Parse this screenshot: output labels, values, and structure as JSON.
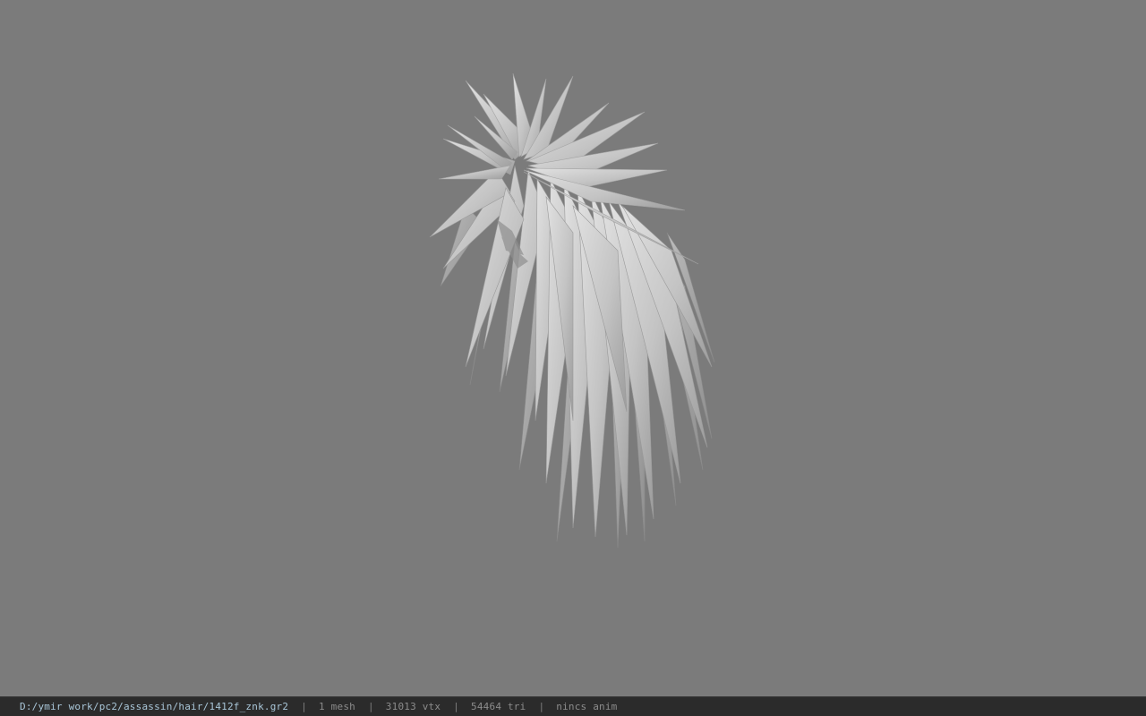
{
  "viewport": {
    "background": "#7b7b7b",
    "model_color": "#c9c9c9",
    "model_shadow": "#9a9a9a"
  },
  "status": {
    "file_path": "D:/ymir work/pc2/assassin/hair/1412f_znk.gr2",
    "separator": "|",
    "mesh": "1 mesh",
    "vtx": "31013 vtx",
    "tri": "54464 tri",
    "anim": "nincs anim"
  }
}
